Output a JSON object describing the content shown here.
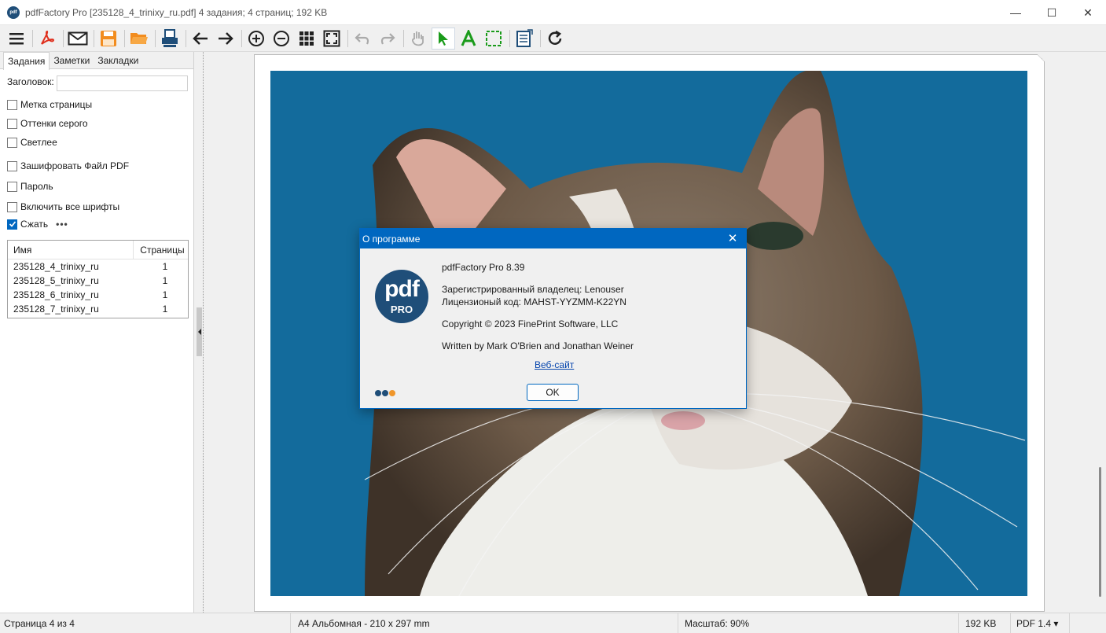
{
  "window": {
    "app_icon_text": "pdf",
    "title": "pdfFactory Pro [235128_4_trinixy_ru.pdf] 4 задания; 4 страниц; 192 KB",
    "minimize": "—",
    "maximize": "☐",
    "close": "✕"
  },
  "toolbar": {
    "icons": [
      "menu-icon",
      "pdf-icon",
      "mail-icon",
      "save-icon",
      "open-folder-icon",
      "print-icon",
      "arrow-left-icon",
      "arrow-right-icon",
      "zoom-in-icon",
      "zoom-out-icon",
      "grid-icon",
      "fit-page-icon",
      "undo-icon",
      "redo-icon",
      "hand-icon",
      "select-arrow-icon",
      "text-tool-icon",
      "crop-icon",
      "notes-icon",
      "refresh-icon"
    ]
  },
  "leftpanel": {
    "tabs": [
      "Задания",
      "Заметки",
      "Закладки"
    ],
    "heading_label": "Заголовок:",
    "heading_value": "",
    "options": [
      {
        "label": "Метка страницы",
        "checked": false
      },
      {
        "label": "Оттенки серого",
        "checked": false
      },
      {
        "label": "Светлее",
        "checked": false
      },
      {
        "label": "Зашифровать Файл PDF",
        "checked": false
      },
      {
        "label": "Пароль",
        "checked": false
      },
      {
        "label": "Включить все шрифты",
        "checked": false
      },
      {
        "label": "Сжать",
        "checked": true
      }
    ],
    "more_dots": "•••",
    "joblist": {
      "col_name": "Имя",
      "col_pages": "Страницы",
      "rows": [
        {
          "name": "235128_4_trinixy_ru",
          "pages": "1"
        },
        {
          "name": "235128_5_trinixy_ru",
          "pages": "1"
        },
        {
          "name": "235128_6_trinixy_ru",
          "pages": "1"
        },
        {
          "name": "235128_7_trinixy_ru",
          "pages": "1"
        }
      ]
    }
  },
  "statusbar": {
    "page": "Страница 4 из 4",
    "format": "A4 Альбомная - 210 x 297 mm",
    "zoom": "Масштаб: 90%",
    "size": "192 KB",
    "pdf_version": "PDF 1.4 ▾"
  },
  "dialog": {
    "title": "О программе",
    "close": "✕",
    "logo_main": "pdf",
    "logo_sub": "PRO",
    "product": "pdfFactory Pro 8.39",
    "owner": "Зарегистрированный владелец:  Lenouser",
    "license": "Лицензионый код:   MAHST-YYZMM-K22YN",
    "copyright": "Copyright © 2023 FinePrint Software, LLC",
    "written": "Written by Mark O'Brien and Jonathan Weiner",
    "website": "Веб-сайт",
    "ok": "OK",
    "dot_colors": [
      "#1f4e79",
      "#1f4e79",
      "#f0962a"
    ]
  },
  "colors": {
    "accent": "#0067c0",
    "photo_background": "#136b9c"
  }
}
